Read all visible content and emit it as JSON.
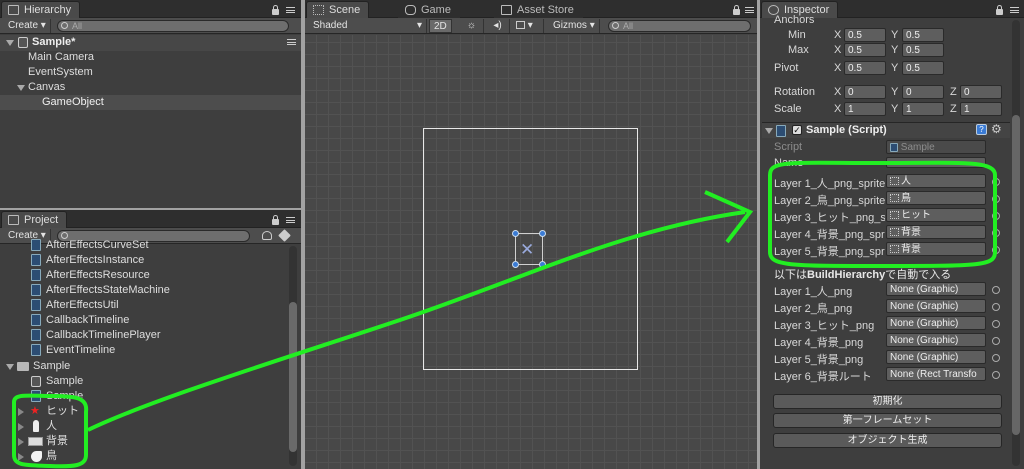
{
  "hierarchy": {
    "tab": "Hierarchy",
    "create": "Create",
    "search_placeholder": "All",
    "scene": "Sample*",
    "items": [
      "Main Camera",
      "EventSystem",
      "Canvas",
      "GameObject"
    ]
  },
  "project": {
    "tab": "Project",
    "create": "Create",
    "scripts": [
      "AfterEffectsCurveSet",
      "AfterEffectsInstance",
      "AfterEffectsResource",
      "AfterEffectsStateMachine",
      "AfterEffectsUtil",
      "CallbackTimeline",
      "CallbackTimelinePlayer",
      "EventTimeline"
    ],
    "folder": "Sample",
    "folder_items": [
      "Sample",
      "Sample"
    ],
    "sprites": [
      "ヒット",
      "人",
      "背景",
      "鳥"
    ]
  },
  "scene_view": {
    "tabs": [
      "Scene",
      "Game",
      "Asset Store"
    ],
    "shading": "Shaded",
    "mode_2d": "2D",
    "gizmos": "Gizmos",
    "search_placeholder": "All"
  },
  "inspector": {
    "tab": "Inspector",
    "anchors_label": "Anchors",
    "min_label": "Min",
    "min": {
      "x": "0.5",
      "y": "0.5"
    },
    "max_label": "Max",
    "max": {
      "x": "0.5",
      "y": "0.5"
    },
    "pivot_label": "Pivot",
    "pivot": {
      "x": "0.5",
      "y": "0.5"
    },
    "rotation_label": "Rotation",
    "rotation": {
      "x": "0",
      "y": "0",
      "z": "0"
    },
    "scale_label": "Scale",
    "scale": {
      "x": "1",
      "y": "1",
      "z": "1"
    },
    "axis": {
      "x": "X",
      "y": "Y",
      "z": "Z"
    },
    "component": "Sample (Script)",
    "script_label": "Script",
    "script_value": "Sample",
    "name_label": "Name",
    "sprite_fields": [
      {
        "label": "Layer 1_人_png_sprite",
        "value": "人"
      },
      {
        "label": "Layer 2_鳥_png_sprite",
        "value": "鳥"
      },
      {
        "label": "Layer 3_ヒット_png_s",
        "value": "ヒット"
      },
      {
        "label": "Layer 4_背景_png_spr",
        "value": "背景"
      },
      {
        "label": "Layer 5_背景_png_spr",
        "value": "背景"
      }
    ],
    "note_prefix": "以下は",
    "note_bold": "BuildHierarchy",
    "note_suffix": "で自動で入る",
    "graphic_fields": [
      {
        "label": "Layer 1_人_png",
        "value": "None (Graphic)"
      },
      {
        "label": "Layer 2_鳥_png",
        "value": "None (Graphic)"
      },
      {
        "label": "Layer 3_ヒット_png",
        "value": "None (Graphic)"
      },
      {
        "label": "Layer 4_背景_png",
        "value": "None (Graphic)"
      },
      {
        "label": "Layer 5_背景_png",
        "value": "None (Graphic)"
      },
      {
        "label": "Layer 6_背景ルート",
        "value": "None (Rect Transfo"
      }
    ],
    "buttons": [
      "初期化",
      "第一フレームセット",
      "オブジェクト生成"
    ]
  },
  "colors": {
    "annotation": "#22ee22",
    "selection": "#4d4d4d",
    "bg": "#3e3e3e"
  }
}
